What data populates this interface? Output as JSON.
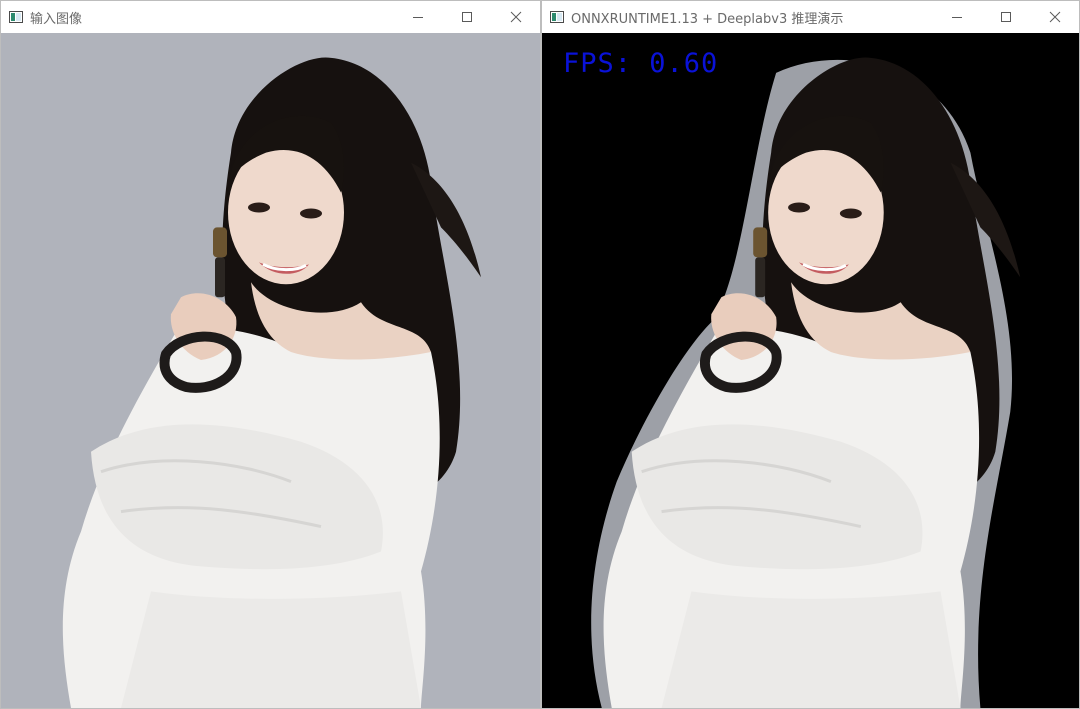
{
  "windows": [
    {
      "title": "输入图像",
      "controls": [
        "minimize-icon",
        "maximize-icon",
        "close-icon"
      ],
      "background": "#b0b3bb"
    },
    {
      "title": "ONNXRUNTIME1.13 + Deeplabv3 推理演示",
      "controls": [
        "minimize-icon",
        "maximize-icon",
        "close-icon"
      ],
      "background": "#000000",
      "overlay": {
        "fps_text": "FPS: 0.60",
        "color": "#0a12d8"
      }
    }
  ]
}
